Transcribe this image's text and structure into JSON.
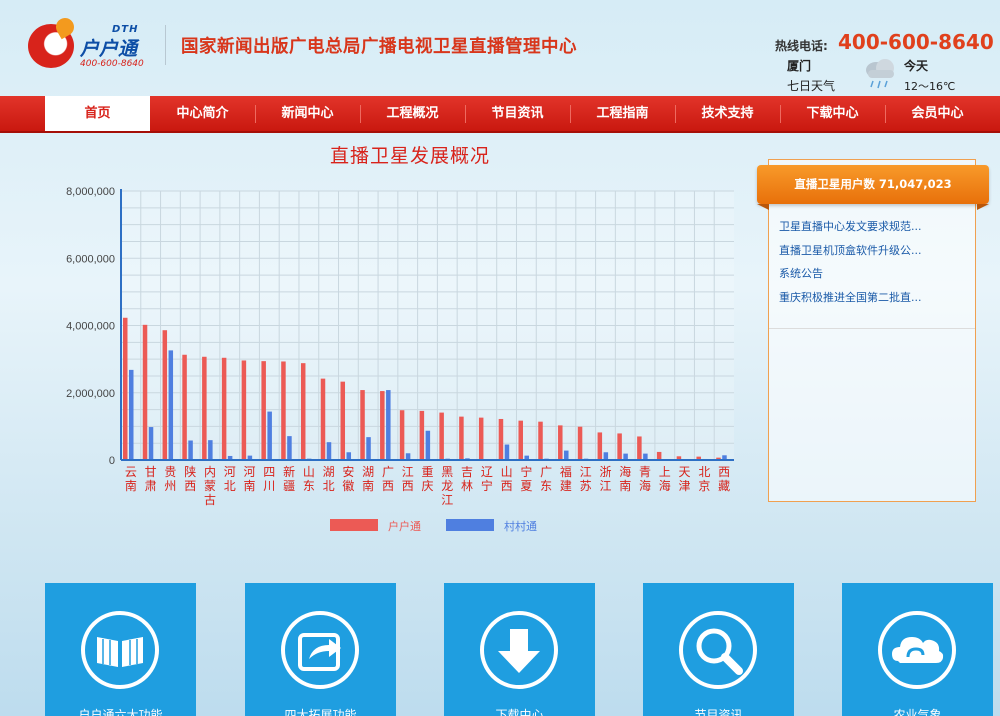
{
  "header": {
    "logo_dth": "DTH",
    "logo_name": "户户通",
    "logo_phone": "400-600-8640",
    "site_title": "国家新闻出版广电总局广播电视卫星直播管理中心",
    "hotline_label": "热线电话:",
    "hotline_number": "400-600-8640"
  },
  "weather": {
    "city": "厦门",
    "forecast_label": "七日天气",
    "today_label": "今天",
    "temperature": "12～16℃",
    "icon": "rain-cloud-icon"
  },
  "nav": {
    "items": [
      "首页",
      "中心简介",
      "新闻中心",
      "工程概况",
      "节目资讯",
      "工程指南",
      "技术支持",
      "下载中心",
      "会员中心"
    ],
    "active_index": 0
  },
  "colors": {
    "nav_red": "#d8231b",
    "series_huhutong": "#ec5a55",
    "series_cuncuntong": "#4f7fe0",
    "side_orange": "#f08a1a",
    "tile_blue": "#1f9ee0"
  },
  "chart_data": {
    "type": "bar",
    "title": "直播卫星发展概况",
    "categories": [
      "云南",
      "甘肃",
      "贵州",
      "陕西",
      "内蒙古",
      "河北",
      "河南",
      "四川",
      "新疆",
      "山东",
      "湖北",
      "安徽",
      "湖南",
      "广西",
      "江西",
      "重庆",
      "黑龙江",
      "吉林",
      "辽宁",
      "山西",
      "宁夏",
      "广东",
      "福建",
      "江苏",
      "浙江",
      "海南",
      "青海",
      "上海",
      "天津",
      "北京",
      "西藏"
    ],
    "series": [
      {
        "name": "户户通",
        "color": "#ec5a55",
        "values": [
          4230000,
          4020000,
          3860000,
          3130000,
          3070000,
          3040000,
          2960000,
          2940000,
          2930000,
          2880000,
          2420000,
          2330000,
          2080000,
          2050000,
          1480000,
          1460000,
          1410000,
          1290000,
          1260000,
          1220000,
          1170000,
          1140000,
          1030000,
          990000,
          820000,
          790000,
          700000,
          240000,
          110000,
          100000,
          70000
        ]
      },
      {
        "name": "村村通",
        "color": "#4f7fe0",
        "values": [
          2680000,
          980000,
          3260000,
          580000,
          590000,
          120000,
          130000,
          1440000,
          710000,
          40000,
          530000,
          230000,
          680000,
          2080000,
          200000,
          870000,
          40000,
          50000,
          20000,
          460000,
          130000,
          40000,
          280000,
          40000,
          230000,
          190000,
          190000,
          20000,
          20000,
          30000,
          140000
        ]
      }
    ],
    "ylim": [
      0,
      8000000
    ],
    "y_ticks": [
      "0",
      "2,000,000",
      "4,000,000",
      "6,000,000",
      "8,000,000"
    ],
    "grid": true,
    "legend_position": "bottom"
  },
  "side_panel": {
    "heading_label": "直播卫星用户数",
    "heading_value": "71,047,023",
    "news": [
      "卫星直播中心发文要求规范...",
      "直播卫星机顶盒软件升级公...",
      "系统公告",
      "重庆积极推进全国第二批直..."
    ]
  },
  "tiles": [
    {
      "label": "户户通六大功能",
      "icon": "book-icon"
    },
    {
      "label": "四大拓展功能",
      "icon": "share-arrow-icon"
    },
    {
      "label": "下载中心",
      "icon": "download-arrow-icon"
    },
    {
      "label": "节目资讯",
      "icon": "magnifier-icon"
    },
    {
      "label": "农业气象",
      "icon": "cloud-icon"
    }
  ]
}
